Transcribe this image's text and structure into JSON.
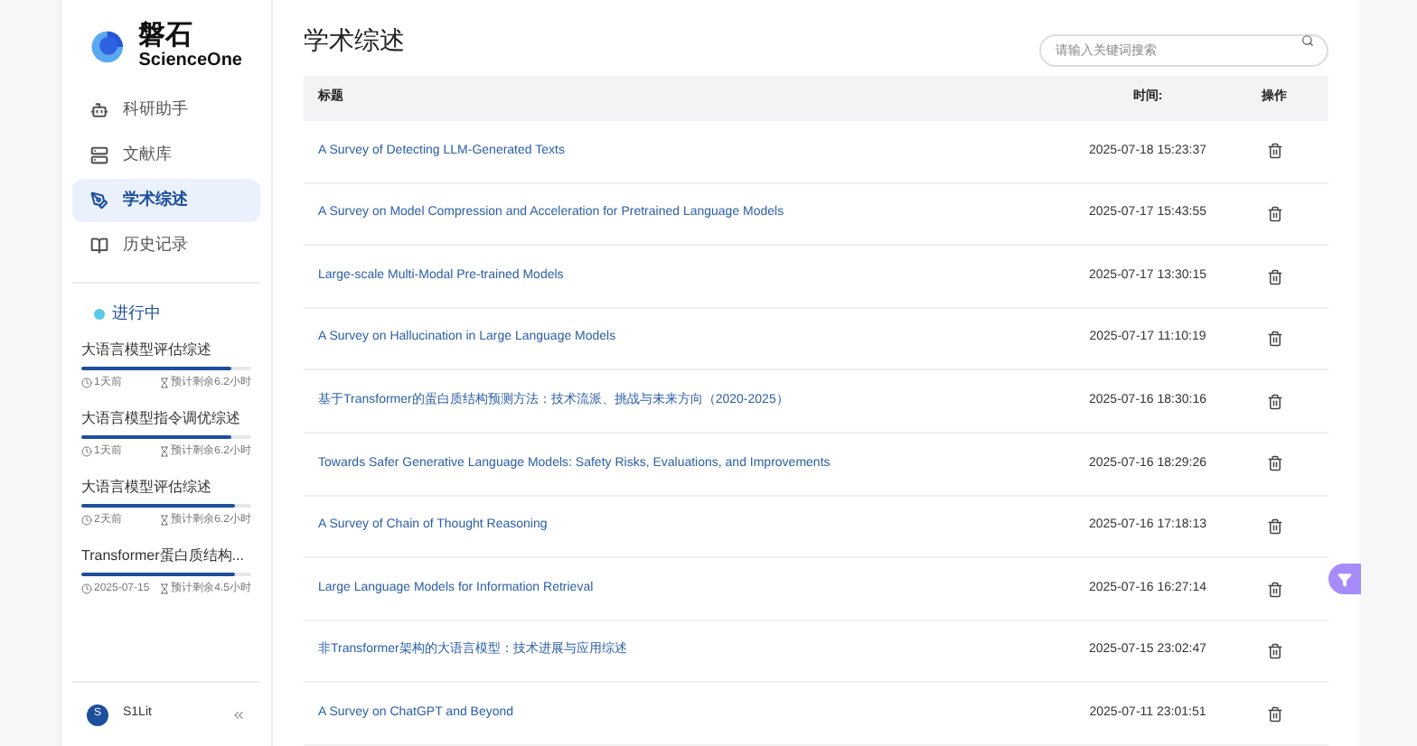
{
  "brand": {
    "name": "磐石",
    "subtitle": "ScienceOne"
  },
  "nav": [
    {
      "label": "科研助手",
      "selected": false
    },
    {
      "label": "文献库",
      "selected": false
    },
    {
      "label": "学术综述",
      "selected": true
    },
    {
      "label": "历史记录",
      "selected": false
    }
  ],
  "in_progress": {
    "title": "进行中",
    "items": [
      {
        "title": "大语言模型评估综述",
        "level": 0.88,
        "time": "1天前",
        "remaining": "预计剩余6.2小时"
      },
      {
        "title": "大语言模型指令调优综述",
        "level": 0.88,
        "time": "1天前",
        "remaining": "预计剩余6.2小时"
      },
      {
        "title": "大语言模型评估综述",
        "level": 0.9,
        "time": "2天前",
        "remaining": "预计剩余6.2小时"
      },
      {
        "title": "Transformer蛋白质结构...",
        "level": 0.9,
        "time": "2025-07-15",
        "remaining": "预计剩余4.5小时"
      }
    ]
  },
  "user": {
    "initial": "S",
    "name": "S1Lit"
  },
  "page_title": "学术综述",
  "search": {
    "placeholder": "请输入关键词搜索"
  },
  "table": {
    "columns": [
      "标题",
      "时间:",
      "操作"
    ],
    "rows": [
      {
        "title": "A Survey of Detecting LLM-Generated Texts",
        "time": "2025-07-18 15:23:37"
      },
      {
        "title": "A Survey on Model Compression and Acceleration for Pretrained Language Models",
        "time": "2025-07-17 15:43:55"
      },
      {
        "title": "Large-scale Multi-Modal Pre-trained Models",
        "time": "2025-07-17 13:30:15"
      },
      {
        "title": "A Survey on Hallucination in Large Language Models",
        "time": "2025-07-17 11:10:19"
      },
      {
        "title": "基于Transformer的蛋白质结构预测方法：技术流派、挑战与未来方向（2020-2025）",
        "time": "2025-07-16 18:30:16"
      },
      {
        "title": "Towards Safer Generative Language Models: Safety Risks, Evaluations, and Improvements",
        "time": "2025-07-16 18:29:26"
      },
      {
        "title": "A Survey of Chain of Thought Reasoning",
        "time": "2025-07-16 17:18:13"
      },
      {
        "title": "Large Language Models for Information Retrieval",
        "time": "2025-07-16 16:27:14"
      },
      {
        "title": "非Transformer架构的大语言模型：技术进展与应用综述",
        "time": "2025-07-15 23:02:47"
      },
      {
        "title": "A Survey on ChatGPT and Beyond",
        "time": "2025-07-11 23:01:51"
      }
    ]
  }
}
